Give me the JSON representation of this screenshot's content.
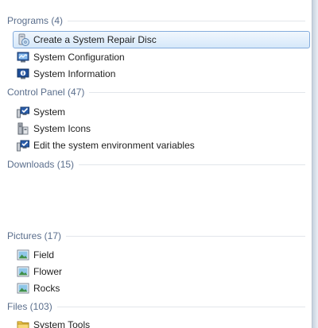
{
  "groups": {
    "programs": {
      "header": "Programs (4)",
      "items": [
        {
          "label": "Create a System Repair Disc",
          "icon": "repair-disc-icon",
          "selected": true
        },
        {
          "label": "System Configuration",
          "icon": "system-config-icon"
        },
        {
          "label": "System Information",
          "icon": "system-info-icon"
        }
      ]
    },
    "control_panel": {
      "header": "Control Panel (47)",
      "items": [
        {
          "label": "System",
          "icon": "computer-check-icon"
        },
        {
          "label": "System Icons",
          "icon": "system-icons-icon"
        },
        {
          "label": "Edit the system environment variables",
          "icon": "computer-check-icon"
        }
      ]
    },
    "downloads": {
      "header": "Downloads (15)",
      "items": []
    },
    "pictures": {
      "header": "Pictures (17)",
      "items": [
        {
          "label": "Field",
          "icon": "picture-icon"
        },
        {
          "label": "Flower",
          "icon": "picture-icon"
        },
        {
          "label": "Rocks",
          "icon": "picture-icon"
        }
      ]
    },
    "files": {
      "header": "Files (103)",
      "items": [
        {
          "label": "System Tools",
          "icon": "folder-icon"
        }
      ]
    }
  },
  "colors": {
    "header_text": "#5a6e8c",
    "selection_border": "#84acdd",
    "panel_background": "#ffffff"
  }
}
